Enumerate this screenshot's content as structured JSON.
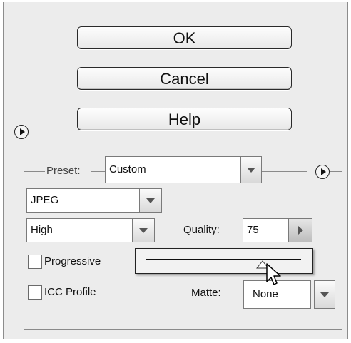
{
  "buttons": {
    "ok": "OK",
    "cancel": "Cancel",
    "help": "Help"
  },
  "preset": {
    "label": "Preset:",
    "value": "Custom"
  },
  "format": {
    "value": "JPEG"
  },
  "quality_level": {
    "value": "High"
  },
  "quality": {
    "label": "Quality:",
    "value": "75",
    "slider_fraction": 0.75
  },
  "options": {
    "progressive_label": "Progressive",
    "icc_profile_label": "ICC Profile"
  },
  "matte": {
    "label": "Matte:",
    "value": "None"
  },
  "icons": [
    "options-menu-icon",
    "preset-menu-icon",
    "chevron-down-icon",
    "chevron-right-icon",
    "slider-thumb-icon",
    "mouse-pointer-icon"
  ]
}
